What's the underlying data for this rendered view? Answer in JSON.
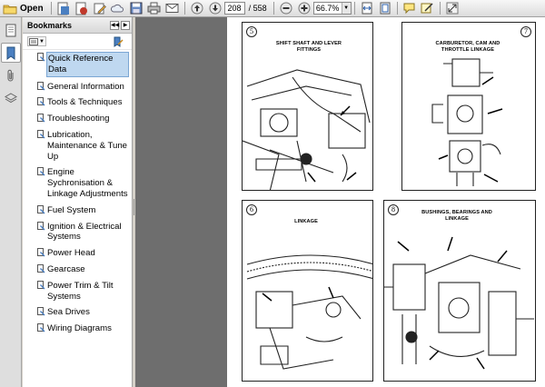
{
  "toolbar": {
    "open_label": "Open",
    "current_page": "208",
    "page_separator": "/ 558",
    "zoom": "66.7%"
  },
  "panel": {
    "title": "Bookmarks"
  },
  "bookmarks": [
    {
      "label": "Quick Reference Data",
      "selected": true
    },
    {
      "label": "General Information"
    },
    {
      "label": "Tools & Techniques"
    },
    {
      "label": "Troubleshooting"
    },
    {
      "label": "Lubrication, Maintenance & Tune Up"
    },
    {
      "label": "Engine Sychronisation & Linkage Adjustments"
    },
    {
      "label": "Fuel System"
    },
    {
      "label": "Ignition & Electrical Systems"
    },
    {
      "label": "Power Head"
    },
    {
      "label": "Gearcase"
    },
    {
      "label": "Power Trim & Tilt Systems"
    },
    {
      "label": "Sea Drives"
    },
    {
      "label": "Wiring Diagrams"
    }
  ],
  "figures": [
    {
      "number": "5",
      "caption": "SHIFT SHAFT AND LEVER FITTINGS"
    },
    {
      "number": "7",
      "caption": "CARBURETOR, CAM AND THROTTLE LINKAGE"
    },
    {
      "number": "6",
      "caption": "LINKAGE"
    },
    {
      "number": "8",
      "caption": "BUSHINGS, BEARINGS AND LINKAGE"
    }
  ]
}
